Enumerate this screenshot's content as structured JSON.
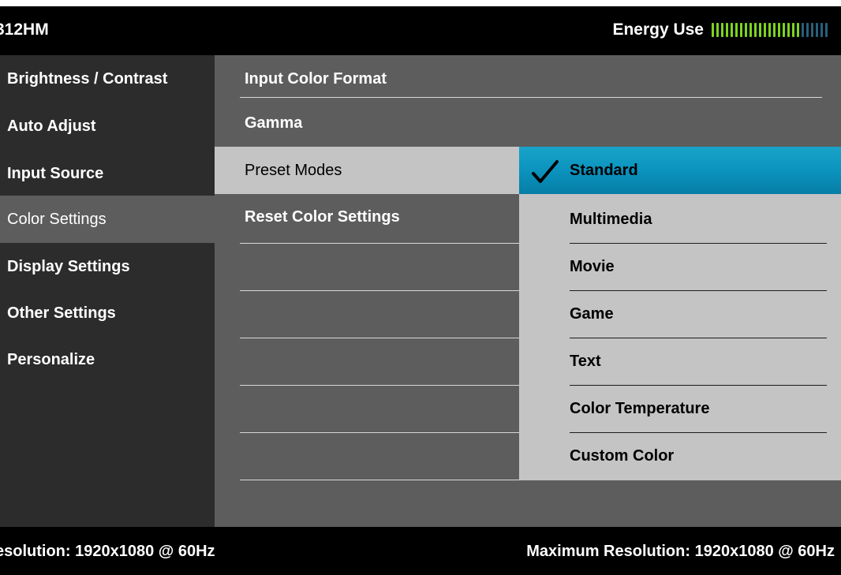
{
  "header": {
    "model": "312HM",
    "energy_label": "Energy Use",
    "energy_level_fraction": 0.76,
    "energy_segments": 25,
    "energy_active_color": "#7ed321",
    "energy_inactive_color": "#2a5f7a"
  },
  "main_menu": {
    "items": [
      {
        "label": "Brightness / Contrast"
      },
      {
        "label": "Auto Adjust"
      },
      {
        "label": "Input Source"
      },
      {
        "label": "Color Settings",
        "selected": true
      },
      {
        "label": "Display Settings"
      },
      {
        "label": "Other Settings"
      },
      {
        "label": "Personalize"
      }
    ]
  },
  "color_settings_menu": {
    "items": [
      {
        "label": "Input Color Format"
      },
      {
        "label": "Gamma"
      },
      {
        "label": "Preset Modes",
        "selected": true
      },
      {
        "label": "Reset Color Settings"
      }
    ]
  },
  "preset_modes": {
    "check_icon": "checkmark-icon",
    "items": [
      {
        "label": "Standard",
        "active": true
      },
      {
        "label": "Multimedia"
      },
      {
        "label": "Movie"
      },
      {
        "label": "Game"
      },
      {
        "label": "Text"
      },
      {
        "label": "Color Temperature"
      },
      {
        "label": "Custom Color"
      }
    ]
  },
  "footer": {
    "resolution": "esolution: 1920x1080 @ 60Hz",
    "max_resolution": "Maximum Resolution: 1920x1080 @ 60Hz"
  },
  "colors": {
    "highlight": "#0b93be",
    "panel_light": "#c4c4c4",
    "panel_mid": "#5d5d5d",
    "panel_dark": "#2c2c2c"
  }
}
